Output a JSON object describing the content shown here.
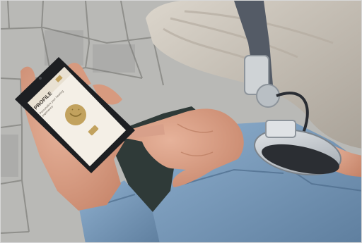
{
  "phone_screen": {
    "heading": "PROFILE",
    "subtext_line1": "Personalize your hearing",
    "subtext_line2": "experience"
  },
  "colors": {
    "pavement": "#b9b9b6",
    "pavement_joint": "#8f8f8b",
    "hair": "#c9c2b6",
    "denim": "#7e9dbb",
    "denim_dark": "#5f7f9f",
    "trousers": "#2f3a38",
    "skin": "#d79a7f",
    "phone_body": "#1d1f22",
    "screen_bg": "#f4efe6",
    "gold_accent": "#c2a25e",
    "headphone_silver": "#cfd3d6",
    "headphone_band": "#545b66"
  }
}
